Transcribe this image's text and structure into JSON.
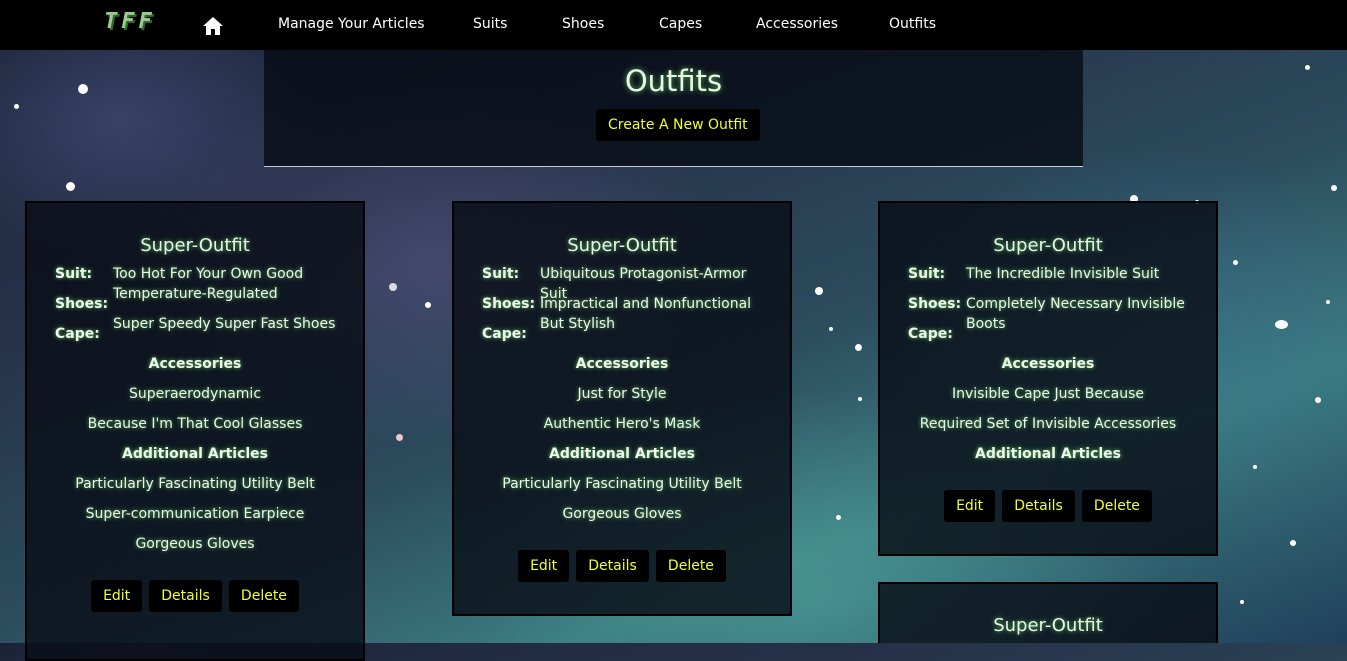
{
  "nav": {
    "logo": "TFF",
    "links": [
      "Manage Your Articles",
      "Suits",
      "Shoes",
      "Capes",
      "Accessories",
      "Outfits"
    ]
  },
  "header": {
    "title": "Outfits",
    "create_label": "Create A New Outfit"
  },
  "labels": {
    "suit": "Suit:",
    "shoes": "Shoes:",
    "cape": "Cape:",
    "accessories": "Accessories",
    "additional": "Additional Articles",
    "edit": "Edit",
    "details": "Details",
    "delete": "Delete"
  },
  "cards": [
    {
      "title": "Super-Outfit",
      "suit": "Too Hot For Your Own Good Temperature-Regulated",
      "shoes": "",
      "cape": "Super Speedy Super Fast Shoes",
      "accessories": [
        "Superaerodynamic",
        "Because I'm That Cool Glasses"
      ],
      "additional": [
        "Particularly Fascinating Utility Belt",
        "Super-communication Earpiece",
        "Gorgeous Gloves"
      ]
    },
    {
      "title": "Super-Outfit",
      "suit": "Ubiquitous Protagonist-Armor Suit",
      "shoes": "Impractical and Nonfunctional But Stylish",
      "cape": "",
      "accessories": [
        "Just for Style",
        "Authentic Hero's Mask"
      ],
      "additional": [
        "Particularly Fascinating Utility Belt",
        "Gorgeous Gloves"
      ]
    },
    {
      "title": "Super-Outfit",
      "suit": "The Incredible Invisible Suit",
      "shoes": "Completely Necessary Invisible Boots",
      "cape": "",
      "accessories": [
        "Invisible Cape Just Because",
        "Required Set of Invisible Accessories"
      ],
      "additional": []
    },
    {
      "title": "Super-Outfit"
    }
  ],
  "colors": {
    "button_text": "#f2ff30",
    "glow": "#62c262",
    "nav_bg": "#000000"
  }
}
